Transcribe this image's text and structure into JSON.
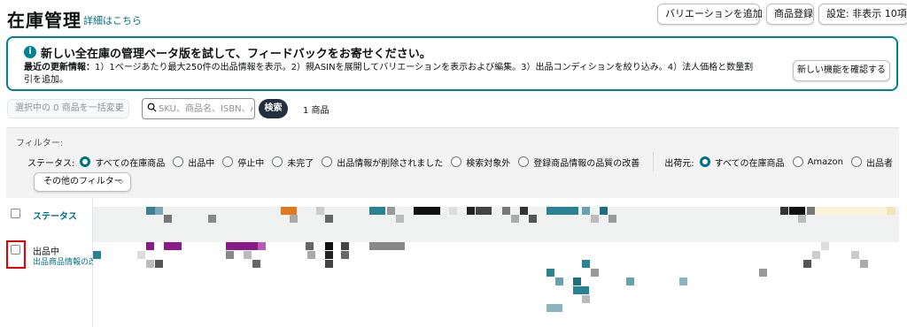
{
  "header": {
    "title": "在庫管理",
    "details_link": "詳細はこちら",
    "buttons": {
      "add_variation": "バリエーションを追加",
      "register_product": "商品登録",
      "settings": "設定: 非表示 10項目"
    }
  },
  "banner": {
    "icon": "info-icon",
    "title": "新しい全在庫の管理ベータ版を試して、フィードバックをお寄せください。",
    "body_lead": "最近の更新情報：",
    "body": "1）1ページあたり最大250件の出品情報を表示。2）親ASINを展開してバリエーションを表示および編集。3）出品コンディションを絞り込み。4）法人価格と数量割引を追加。",
    "button": "新しい機能を確認する"
  },
  "toolbar": {
    "bulk_select": "選択中の 0 商品を一括変更",
    "search_placeholder": "SKU、商品名、ISBN、ASIN",
    "search_button": "検索",
    "count": "1 商品"
  },
  "filters": {
    "heading": "フィルター:",
    "status_label": "ステータス:",
    "status_options": [
      {
        "label": "すべての在庫商品",
        "selected": true
      },
      {
        "label": "出品中",
        "selected": false
      },
      {
        "label": "停止中",
        "selected": false
      },
      {
        "label": "未完了",
        "selected": false
      },
      {
        "label": "出品情報が削除されました",
        "selected": false
      },
      {
        "label": "検索対象外",
        "selected": false
      },
      {
        "label": "登録商品情報の品質の改善",
        "selected": false
      }
    ],
    "fulfillment_label": "出荷元:",
    "fulfillment_options": [
      {
        "label": "すべての在庫商品",
        "selected": true
      },
      {
        "label": "Amazon",
        "selected": false
      },
      {
        "label": "出品者",
        "selected": false
      }
    ],
    "more_filters": "その他のフィルター"
  },
  "table": {
    "column_status": "ステータス",
    "row": {
      "status": "出品中",
      "substatus": "出品商品情報の改善"
    }
  },
  "colors": {
    "accent_teal": "#008296",
    "link": "#007185",
    "dark_button": "#232f3e",
    "highlight_red": "#e60000"
  }
}
